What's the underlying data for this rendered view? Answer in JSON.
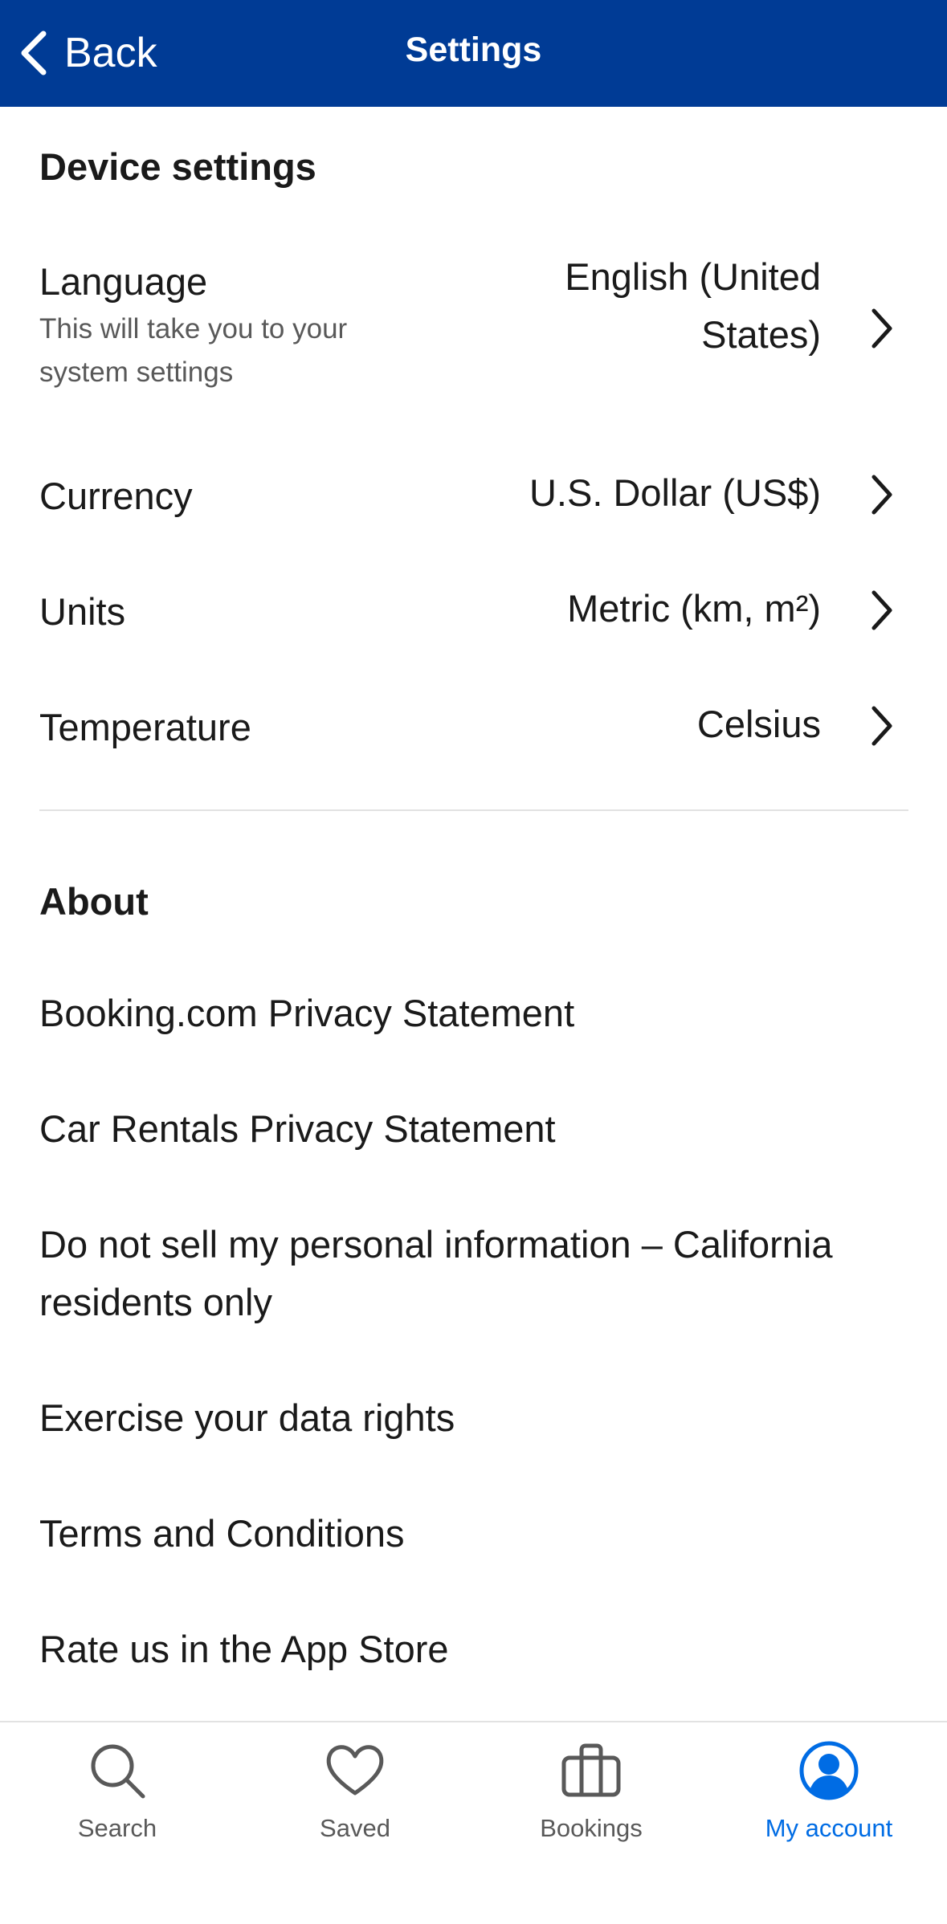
{
  "navbar": {
    "back_label": "Back",
    "title": "Settings"
  },
  "device_settings": {
    "title": "Device settings",
    "rows": [
      {
        "label": "Language",
        "sub": "This will take you to your system settings",
        "value_line1": "English (United",
        "value_line2": "States)"
      },
      {
        "label": "Currency",
        "value": "U.S. Dollar (US$)"
      },
      {
        "label": "Units",
        "value": "Metric (km, m²)"
      },
      {
        "label": "Temperature",
        "value": "Celsius"
      }
    ]
  },
  "about": {
    "title": "About",
    "items": [
      "Booking.com Privacy Statement",
      "Car Rentals Privacy Statement",
      "Do not sell my personal information – California residents only",
      "Exercise your data rights",
      "Terms and Conditions",
      "Rate us in the App Store"
    ]
  },
  "tabbar": {
    "tabs": [
      {
        "label": "Search",
        "icon": "search-icon"
      },
      {
        "label": "Saved",
        "icon": "heart-icon"
      },
      {
        "label": "Bookings",
        "icon": "suitcase-icon"
      },
      {
        "label": "My account",
        "icon": "account-icon",
        "active": true
      }
    ]
  },
  "colors": {
    "header": "#003b95",
    "active_tab": "#006ce4",
    "secondary_text": "#595959"
  }
}
